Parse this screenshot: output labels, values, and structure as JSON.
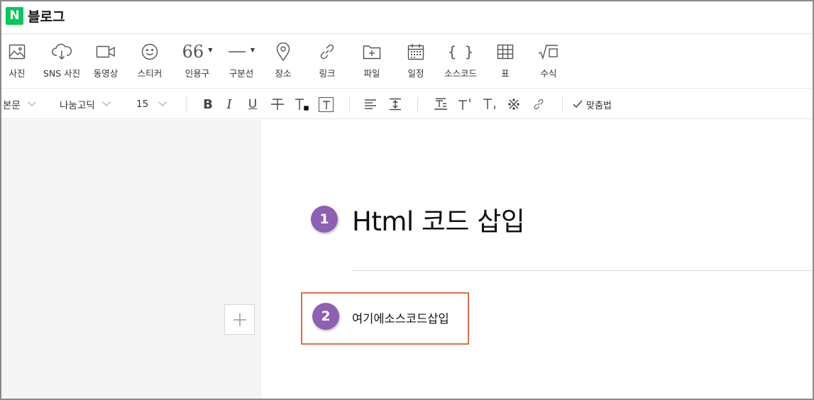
{
  "header": {
    "logo_letter": "N",
    "brand": "블로그"
  },
  "toolbar": {
    "items": [
      {
        "label": "사진",
        "icon": "image-icon"
      },
      {
        "label": "SNS 사진",
        "icon": "cloud-download-icon"
      },
      {
        "label": "동영상",
        "icon": "video-camera-icon"
      },
      {
        "label": "스티커",
        "icon": "smiley-icon"
      },
      {
        "label": "인용구",
        "icon": "quote-icon",
        "glyph": "66"
      },
      {
        "label": "구분선",
        "icon": "horizontal-line-icon"
      },
      {
        "label": "장소",
        "icon": "map-pin-icon"
      },
      {
        "label": "링크",
        "icon": "link-icon"
      },
      {
        "label": "파일",
        "icon": "folder-plus-icon"
      },
      {
        "label": "일정",
        "icon": "calendar-icon"
      },
      {
        "label": "소스코드",
        "icon": "braces-icon",
        "glyph": "{ }"
      },
      {
        "label": "표",
        "icon": "table-icon"
      },
      {
        "label": "수식",
        "icon": "formula-icon"
      }
    ]
  },
  "format": {
    "paragraph_style": "본문",
    "font_family": "나눔고딕",
    "font_size": "15",
    "spellcheck": "맞춤법",
    "bold": "B",
    "italic": "I",
    "underline": "U"
  },
  "document": {
    "title": "Html 코드 삽입",
    "body_placeholder": "여기에소스코드삽입"
  },
  "annotations": {
    "first": "1",
    "second": "2"
  },
  "colors": {
    "brand_green": "#03c75a",
    "badge_purple": "#8e5fb3",
    "highlight_orange": "#d9714a",
    "left_pane_gray": "#f5f5f5"
  }
}
